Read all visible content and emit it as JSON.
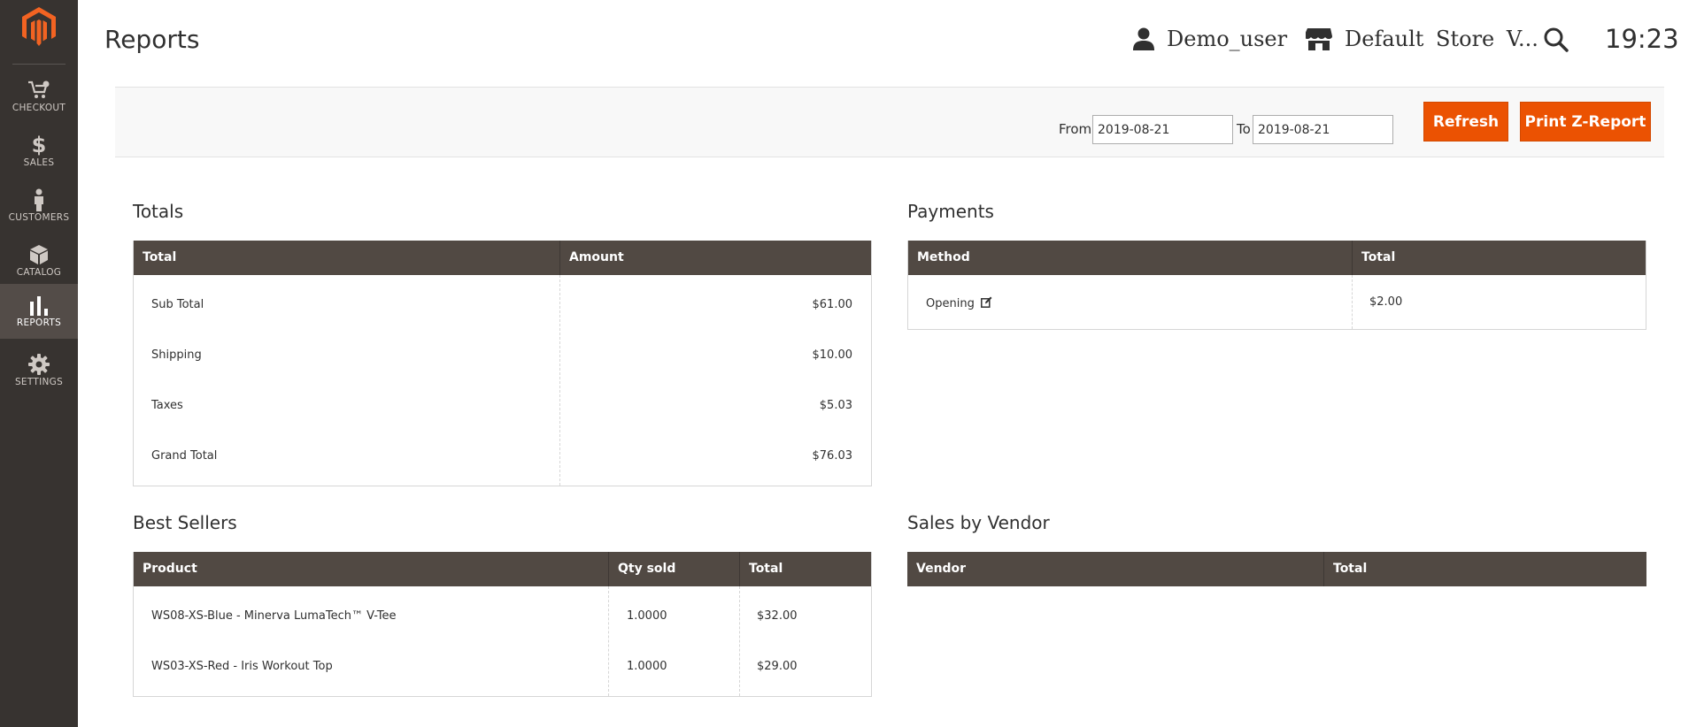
{
  "sidebar": {
    "items": [
      {
        "label": "CHECKOUT",
        "icon": "cart-icon",
        "active": false
      },
      {
        "label": "SALES",
        "icon": "dollar-icon",
        "active": false
      },
      {
        "label": "CUSTOMERS",
        "icon": "person-icon",
        "active": false
      },
      {
        "label": "CATALOG",
        "icon": "box-icon",
        "active": false
      },
      {
        "label": "REPORTS",
        "icon": "bar-chart-icon",
        "active": true
      },
      {
        "label": "SETTINGS",
        "icon": "gear-icon",
        "active": false
      }
    ]
  },
  "header": {
    "title": "Reports",
    "user": "Demo_user",
    "store": "Default Store V...",
    "time": "19:23"
  },
  "filter": {
    "from_label": "From",
    "from_value": "2019-08-21",
    "to_label": "To",
    "to_value": "2019-08-21",
    "refresh_label": "Refresh",
    "print_label": "Print Z-Report"
  },
  "totals": {
    "title": "Totals",
    "columns": [
      "Total",
      "Amount"
    ],
    "rows": [
      [
        "Sub Total",
        "$61.00"
      ],
      [
        "Shipping",
        "$10.00"
      ],
      [
        "Taxes",
        "$5.03"
      ],
      [
        "Grand Total",
        "$76.03"
      ]
    ]
  },
  "payments": {
    "title": "Payments",
    "columns": [
      "Method",
      "Total"
    ],
    "rows": [
      [
        "Opening",
        "$2.00"
      ]
    ]
  },
  "best_sellers": {
    "title": "Best Sellers",
    "columns": [
      "Product",
      "Qty sold",
      "Total"
    ],
    "rows": [
      [
        "WS08-XS-Blue - Minerva LumaTech™ V-Tee",
        "1.0000",
        "$32.00"
      ],
      [
        "WS03-XS-Red - Iris Workout Top",
        "1.0000",
        "$29.00"
      ]
    ]
  },
  "sales_by_vendor": {
    "title": "Sales by Vendor",
    "columns": [
      "Vendor",
      "Total"
    ]
  },
  "colors": {
    "sidebar": "#373330",
    "sidebar_active": "#534c48",
    "table_header": "#514943",
    "accent": "#eb5202",
    "logo": "#f26322"
  }
}
